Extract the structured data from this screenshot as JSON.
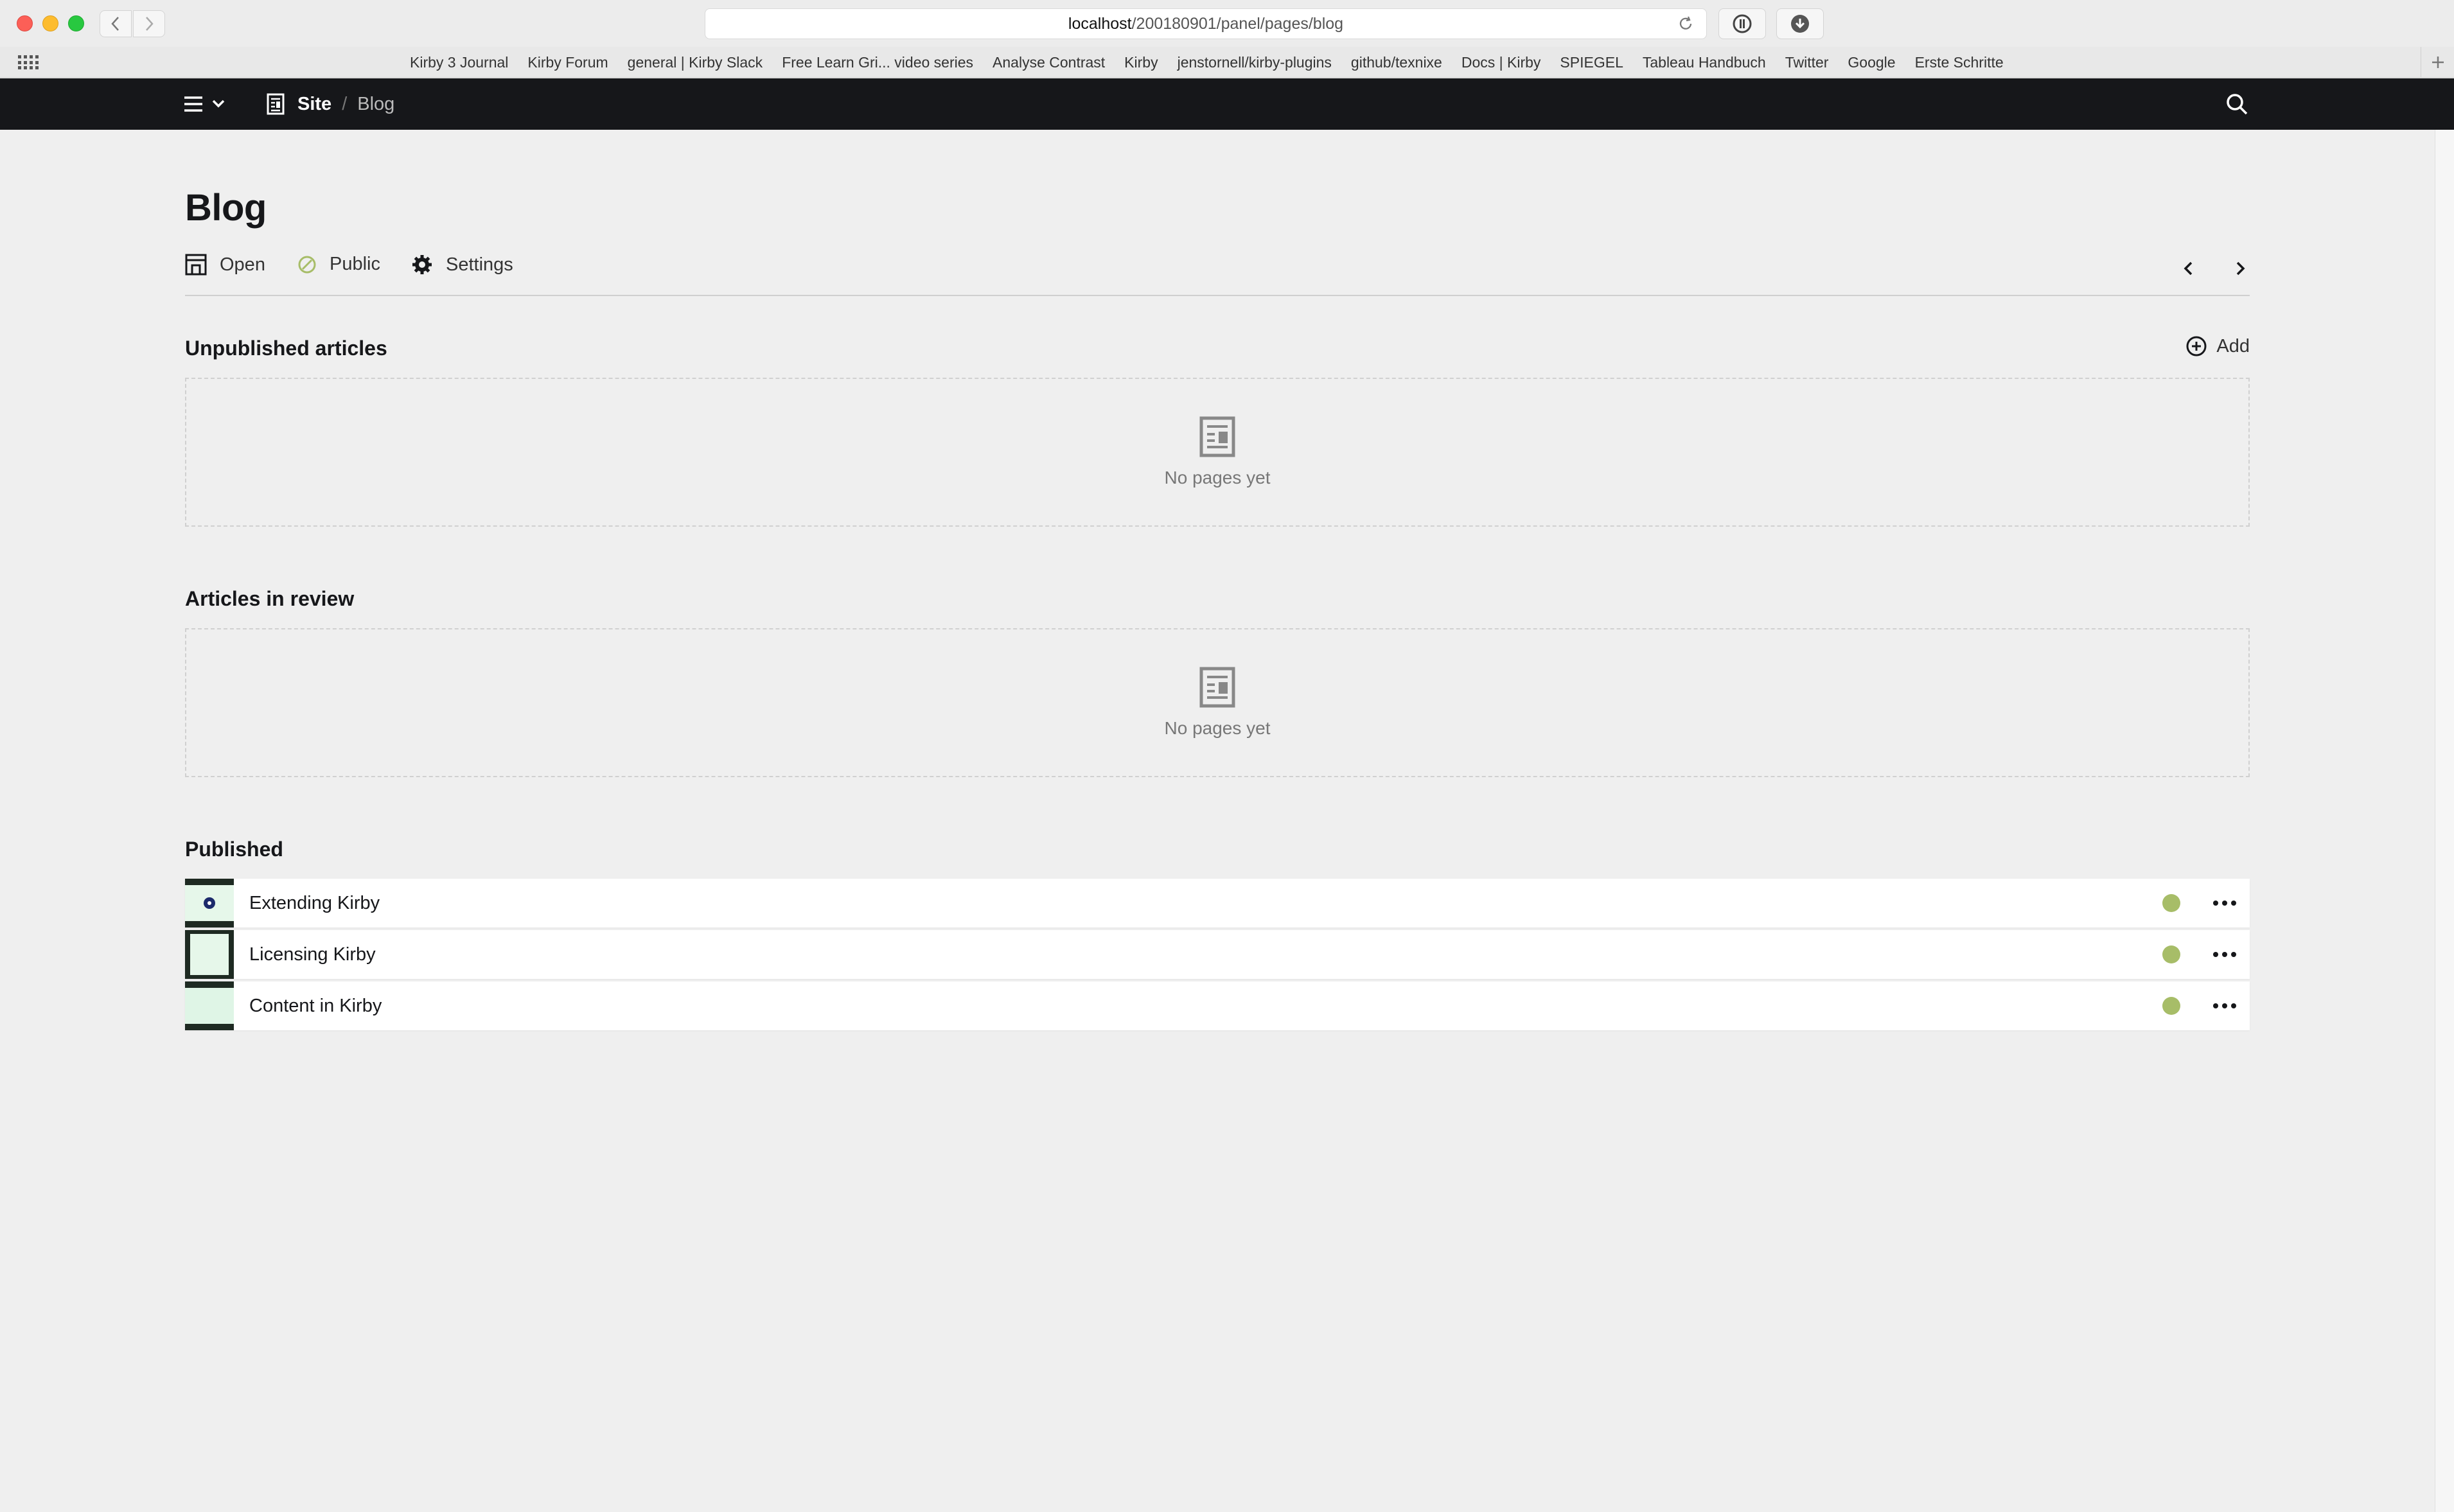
{
  "browser": {
    "url_host": "localhost",
    "url_path": "/200180901/panel/pages/blog",
    "bookmarks": [
      "Kirby 3 Journal",
      "Kirby Forum",
      "general | Kirby Slack",
      "Free Learn Gri... video series",
      "Analyse Contrast",
      "Kirby",
      "jenstornell/kirby-plugins",
      "github/texnixe",
      "Docs | Kirby",
      "SPIEGEL",
      "Tableau Handbuch",
      "Twitter",
      "Google",
      "Erste Schritte"
    ]
  },
  "topbar": {
    "breadcrumb": {
      "site": "Site",
      "separator": "/",
      "current": "Blog"
    }
  },
  "page": {
    "title": "Blog",
    "actions": {
      "open": "Open",
      "status": "Public",
      "settings": "Settings"
    }
  },
  "sections": {
    "unpublished": {
      "title": "Unpublished articles",
      "add_label": "Add",
      "empty_text": "No pages yet"
    },
    "review": {
      "title": "Articles in review",
      "empty_text": "No pages yet"
    },
    "published": {
      "title": "Published",
      "items": [
        {
          "title": "Extending Kirby",
          "status": "published"
        },
        {
          "title": "Licensing Kirby",
          "status": "published"
        },
        {
          "title": "Content in Kirby",
          "status": "published"
        }
      ]
    }
  },
  "colors": {
    "topbar": "#16171a",
    "background": "#efefef",
    "status_published": "#a7bd68",
    "public_icon": "#a7bd68"
  },
  "icons": {
    "menu": "hamburger-icon",
    "page": "page-icon",
    "search": "search-icon",
    "open": "open-icon",
    "public": "circle-slash-icon",
    "settings": "gear-icon",
    "add": "add-circle-icon",
    "more": "more-dots-icon"
  }
}
